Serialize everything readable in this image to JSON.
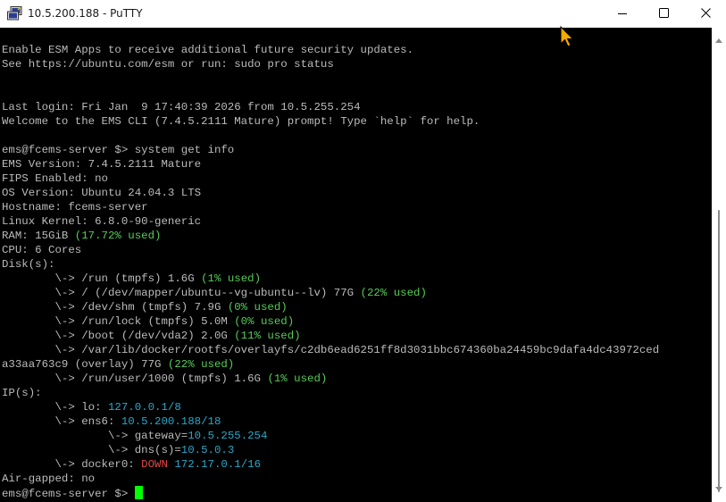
{
  "window": {
    "title": "10.5.200.188 - PuTTY",
    "icons": {
      "app": "putty-icon",
      "minimize": "minimize-icon",
      "maximize": "maximize-icon",
      "close": "close-icon"
    }
  },
  "terminal": {
    "lines": [
      "Enable ESM Apps to receive additional future security updates.",
      "See https://ubuntu.com/esm or run: sudo pro status",
      "",
      "",
      "Last login: Fri Jan  9 17:40:39 2026 from 10.5.255.254",
      "Welcome to the EMS CLI (7.4.5.2111 Mature) prompt! Type `help` for help.",
      "",
      "ems@fcems-server $> system get info",
      "EMS Version: 7.4.5.2111 Mature",
      "FIPS Enabled: no",
      "OS Version: Ubuntu 24.04.3 LTS",
      "Hostname: fcems-server",
      "Linux Kernel: 6.8.0-90-generic",
      "RAM: 15GiB (17.72% used)",
      "CPU: 6 Cores",
      "Disk(s):",
      "        \\-> /run (tmpfs) 1.6G (1% used)",
      "        \\-> / (/dev/mapper/ubuntu--vg-ubuntu--lv) 77G (22% used)",
      "        \\-> /dev/shm (tmpfs) 7.9G (0% used)",
      "        \\-> /run/lock (tmpfs) 5.0M (0% used)",
      "        \\-> /boot (/dev/vda2) 2.0G (11% used)",
      "        \\-> /var/lib/docker/rootfs/overlayfs/c2db6ead6251ff8d3031bbc674360ba24459bc9dafa4dc43972ced",
      "a33aa763c9 (overlay) 77G (22% used)",
      "        \\-> /run/user/1000 (tmpfs) 1.6G (1% used)",
      "IP(s):",
      "        \\-> lo: 127.0.0.1/8",
      "        \\-> ens6: 10.5.200.188/18",
      "                \\-> gateway=10.5.255.254",
      "                \\-> dns(s)=10.5.0.3",
      "        \\-> docker0: DOWN 172.17.0.1/16",
      "Air-gapped: no",
      "ems@fcems-server $> "
    ],
    "colors": {
      "text": "#bbbbbb",
      "used": "#55cc55",
      "ip": "#2aa7c9",
      "down": "#e04848",
      "cursor": "#00ff00",
      "background": "#000000"
    }
  }
}
